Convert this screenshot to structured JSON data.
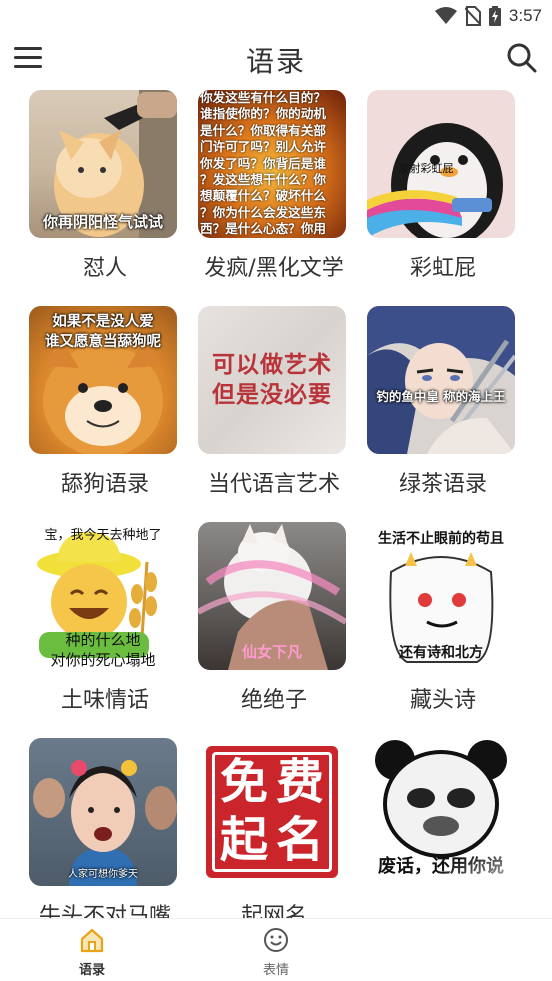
{
  "status": {
    "time": "3:57"
  },
  "header": {
    "title": "语录"
  },
  "colors": {
    "accent": "#e8a317",
    "label": "#333333"
  },
  "categories": [
    {
      "label": "怼人",
      "caption": "你再阴阳怪气试试"
    },
    {
      "label": "发疯/黑化文学",
      "text_lines": [
        "你发这些有什么目的？",
        "谁指使你的？你的动机",
        "是什么？你取得有关部",
        "门许可了吗？别人允许",
        "你发了吗？你背后是谁",
        "？发这些想干什么？你",
        "想颠覆什么？破坏什么",
        "？你为什么会发这些东",
        "西？是什么心态？你用"
      ]
    },
    {
      "label": "彩虹屁",
      "caption": "发射彩虹屁"
    },
    {
      "label": "舔狗语录",
      "caption_lines": [
        "如果不是没人爱",
        "谁又愿意当舔狗呢"
      ]
    },
    {
      "label": "当代语言艺术",
      "caption_lines": [
        "可以做艺术",
        "但是没必要"
      ]
    },
    {
      "label": "绿茶语录",
      "caption": "钓的鱼中皇 称的海上王"
    },
    {
      "label": "土味情话",
      "caption_top": "宝，我今天去种地了",
      "caption_lines": [
        "种的什么地",
        "对你的死心塌地"
      ]
    },
    {
      "label": "绝绝子",
      "caption": "仙女下凡"
    },
    {
      "label": "藏头诗",
      "caption_top": "生活不止眼前的苟且",
      "caption_bottom": "还有诗和北方"
    },
    {
      "label": "牛头不对马嘴",
      "caption": "人家可想你爹天"
    },
    {
      "label": "起网名",
      "seal_chars": [
        "免",
        "费",
        "起",
        "名"
      ]
    },
    {
      "label": "",
      "caption": "废话，还用你说"
    }
  ],
  "bottom_nav": [
    {
      "label": "语录",
      "icon": "home-icon",
      "active": true
    },
    {
      "label": "表情",
      "icon": "smiley-icon",
      "active": false
    }
  ]
}
